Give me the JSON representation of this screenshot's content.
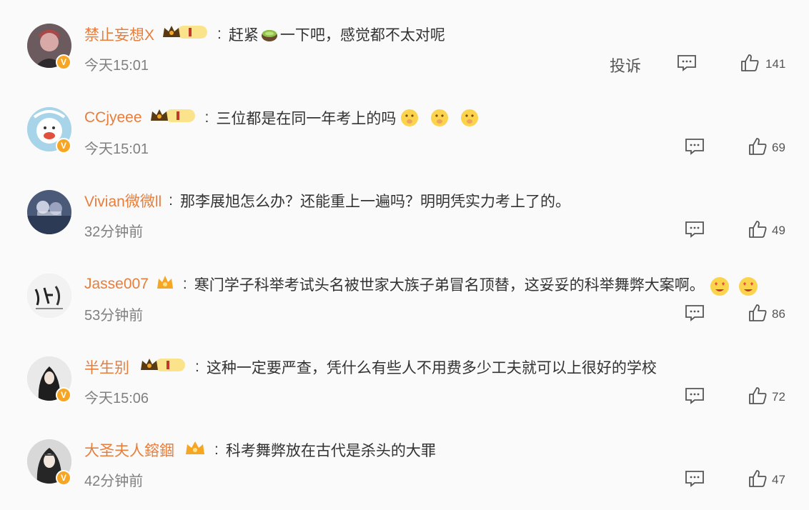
{
  "comments": [
    {
      "username": "禁止妄想X",
      "text_before": "赶紧",
      "text_after": "一下吧，感觉都不太对呢",
      "time": "今天15:01",
      "report": "投诉",
      "likes": "141",
      "vip": true
    },
    {
      "username": "CCjyeee",
      "text": "三位都是在同一年考上的吗",
      "time": "今天15:01",
      "likes": "69",
      "vip": true
    },
    {
      "username": "Vivian微微ll",
      "text": "那李展旭怎么办？还能重上一遍吗？明明凭实力考上了的。",
      "time": "32分钟前",
      "likes": "49",
      "vip": false
    },
    {
      "username": "Jasse007",
      "text": "寒门学子科举考试头名被世家大族子弟冒名顶替，这妥妥的科举舞弊大案啊。",
      "time": "53分钟前",
      "likes": "86",
      "vip": false
    },
    {
      "username": "半生别",
      "text": "这种一定要严查，凭什么有些人不用费多少工夫就可以上很好的学校",
      "time": "今天15:06",
      "likes": "72",
      "vip": true
    },
    {
      "username": "大圣夫人鎔錮",
      "text": "科考舞弊放在古代是杀头的大罪",
      "time": "42分钟前",
      "likes": "47",
      "vip": true
    }
  ],
  "icons": {
    "reply": "comment-icon",
    "like": "thumbs-up-icon",
    "badge": "crown-level-badge"
  },
  "colors": {
    "username": "#e87e3c",
    "time": "#808080",
    "badge": "#f6a623"
  }
}
